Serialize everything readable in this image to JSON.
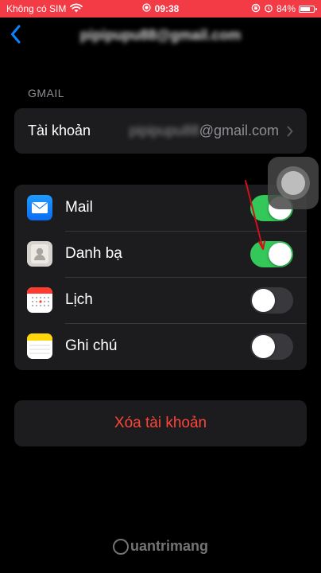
{
  "status_bar": {
    "carrier": "Không có SIM",
    "time": "09:38",
    "battery": "84%",
    "battery_level": 0.84,
    "background": "#f23b45"
  },
  "nav": {
    "back_icon": "chevron-left-icon",
    "title": "pipipupu88@gmail.com"
  },
  "section_header": "GMAIL",
  "account": {
    "label": "Tài khoản",
    "value_hidden": "pipipupu88",
    "value_domain": "@gmail.com"
  },
  "services": [
    {
      "label": "Mail",
      "icon": "mail-app-icon",
      "enabled": true
    },
    {
      "label": "Danh bạ",
      "icon": "contacts-app-icon",
      "enabled": true
    },
    {
      "label": "Lịch",
      "icon": "calendar-app-icon",
      "enabled": false
    },
    {
      "label": "Ghi chú",
      "icon": "notes-app-icon",
      "enabled": false
    }
  ],
  "delete_account": "Xóa tài khoản",
  "watermark": "uantrimang",
  "colors": {
    "toggle_on": "#34c759",
    "delete_red": "#ff453a",
    "accent_blue": "#0a84ff"
  }
}
